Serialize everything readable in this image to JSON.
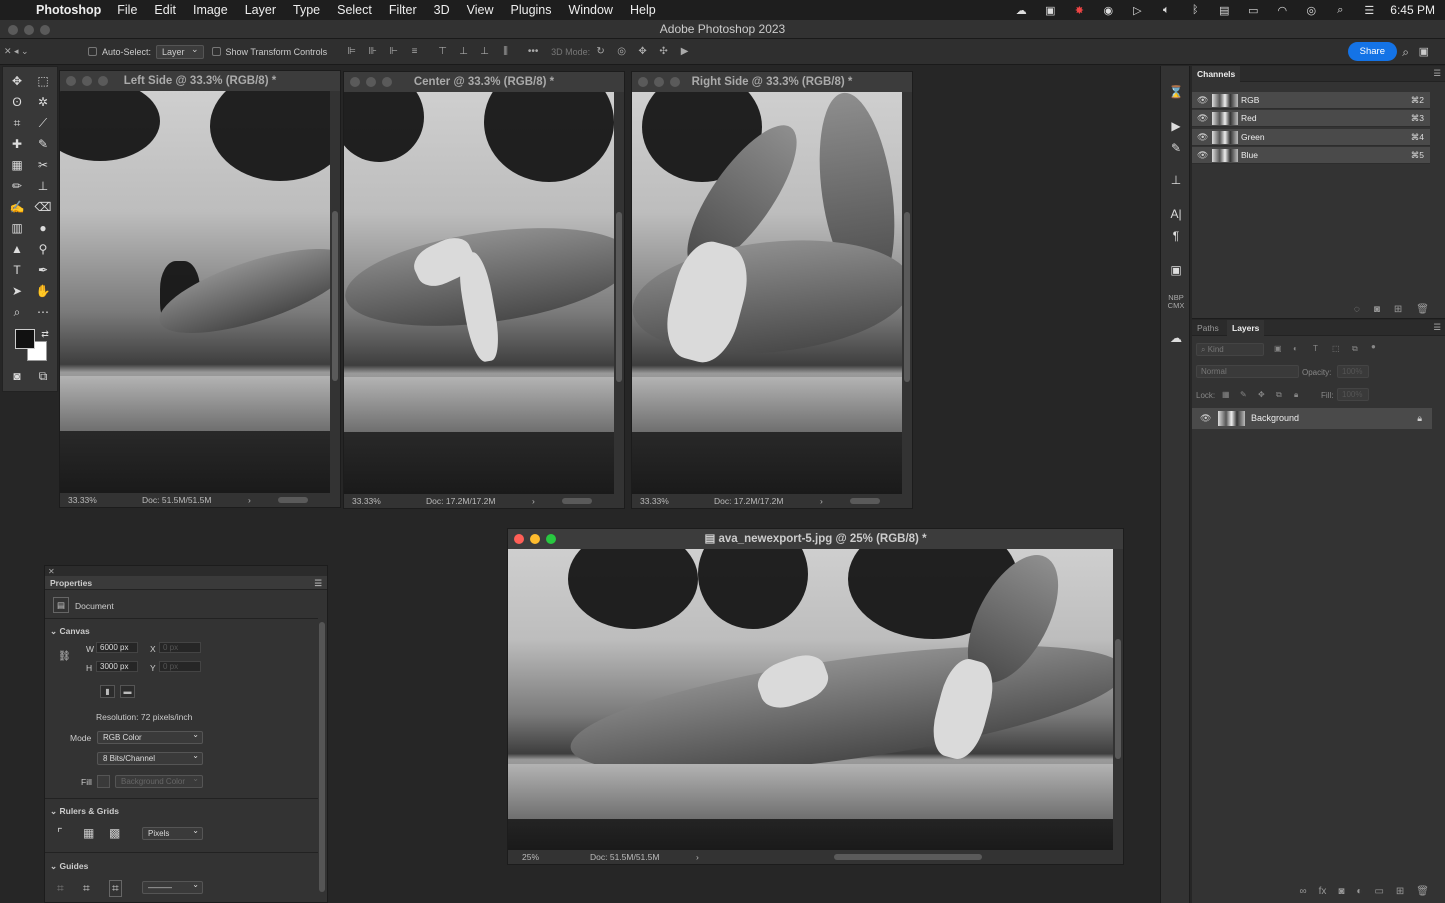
{
  "menubar": {
    "app": "Photoshop",
    "items": [
      "File",
      "Edit",
      "Image",
      "Layer",
      "Type",
      "Select",
      "Filter",
      "3D",
      "View",
      "Plugins",
      "Window",
      "Help"
    ],
    "time": "6:45 PM"
  },
  "app_title": "Adobe Photoshop 2023",
  "options": {
    "auto_select_label": "Auto-Select:",
    "auto_select_value": "Layer",
    "transform_label": "Show Transform Controls",
    "mode_3d_label": "3D Mode:",
    "more": "•••",
    "share": "Share"
  },
  "windows": {
    "left": {
      "title": "Left Side @ 33.3% (RGB/8) *",
      "zoom": "33.33%",
      "doc": "Doc: 51.5M/51.5M"
    },
    "center": {
      "title": "Center @ 33.3% (RGB/8) *",
      "zoom": "33.33%",
      "doc": "Doc: 17.2M/17.2M"
    },
    "right": {
      "title": "Right Side @ 33.3% (RGB/8) *",
      "zoom": "33.33%",
      "doc": "Doc: 17.2M/17.2M"
    },
    "main": {
      "title": "ava_newexport-5.jpg @ 25% (RGB/8) *",
      "zoom": "25%",
      "doc": "Doc: 51.5M/51.5M"
    }
  },
  "properties": {
    "title": "Properties",
    "document_label": "Document",
    "canvas_label": "Canvas",
    "w_label": "W",
    "w_value": "6000 px",
    "x_label": "X",
    "x_placeholder": "0 px",
    "h_label": "H",
    "h_value": "3000 px",
    "y_label": "Y",
    "y_placeholder": "0 px",
    "resolution": "Resolution: 72 pixels/inch",
    "mode_label": "Mode",
    "mode_value": "RGB Color",
    "bits_value": "8 Bits/Channel",
    "fill_label": "Fill",
    "fill_value": "Background Color",
    "rulers_label": "Rulers & Grids",
    "units_value": "Pixels",
    "guides_label": "Guides"
  },
  "channels": {
    "tab": "Channels",
    "rows": [
      {
        "name": "RGB",
        "key": "⌘2"
      },
      {
        "name": "Red",
        "key": "⌘3"
      },
      {
        "name": "Green",
        "key": "⌘4"
      },
      {
        "name": "Blue",
        "key": "⌘5"
      }
    ]
  },
  "layers": {
    "tab_paths": "Paths",
    "tab_layers": "Layers",
    "kind_placeholder": "Kind",
    "blend_mode": "Normal",
    "opacity_label": "Opacity:",
    "opacity_value": "100%",
    "lock_label": "Lock:",
    "fill_label": "Fill:",
    "fill_value": "100%",
    "background_layer": "Background"
  },
  "strip": {
    "nbp_label": "NBP CMX"
  }
}
